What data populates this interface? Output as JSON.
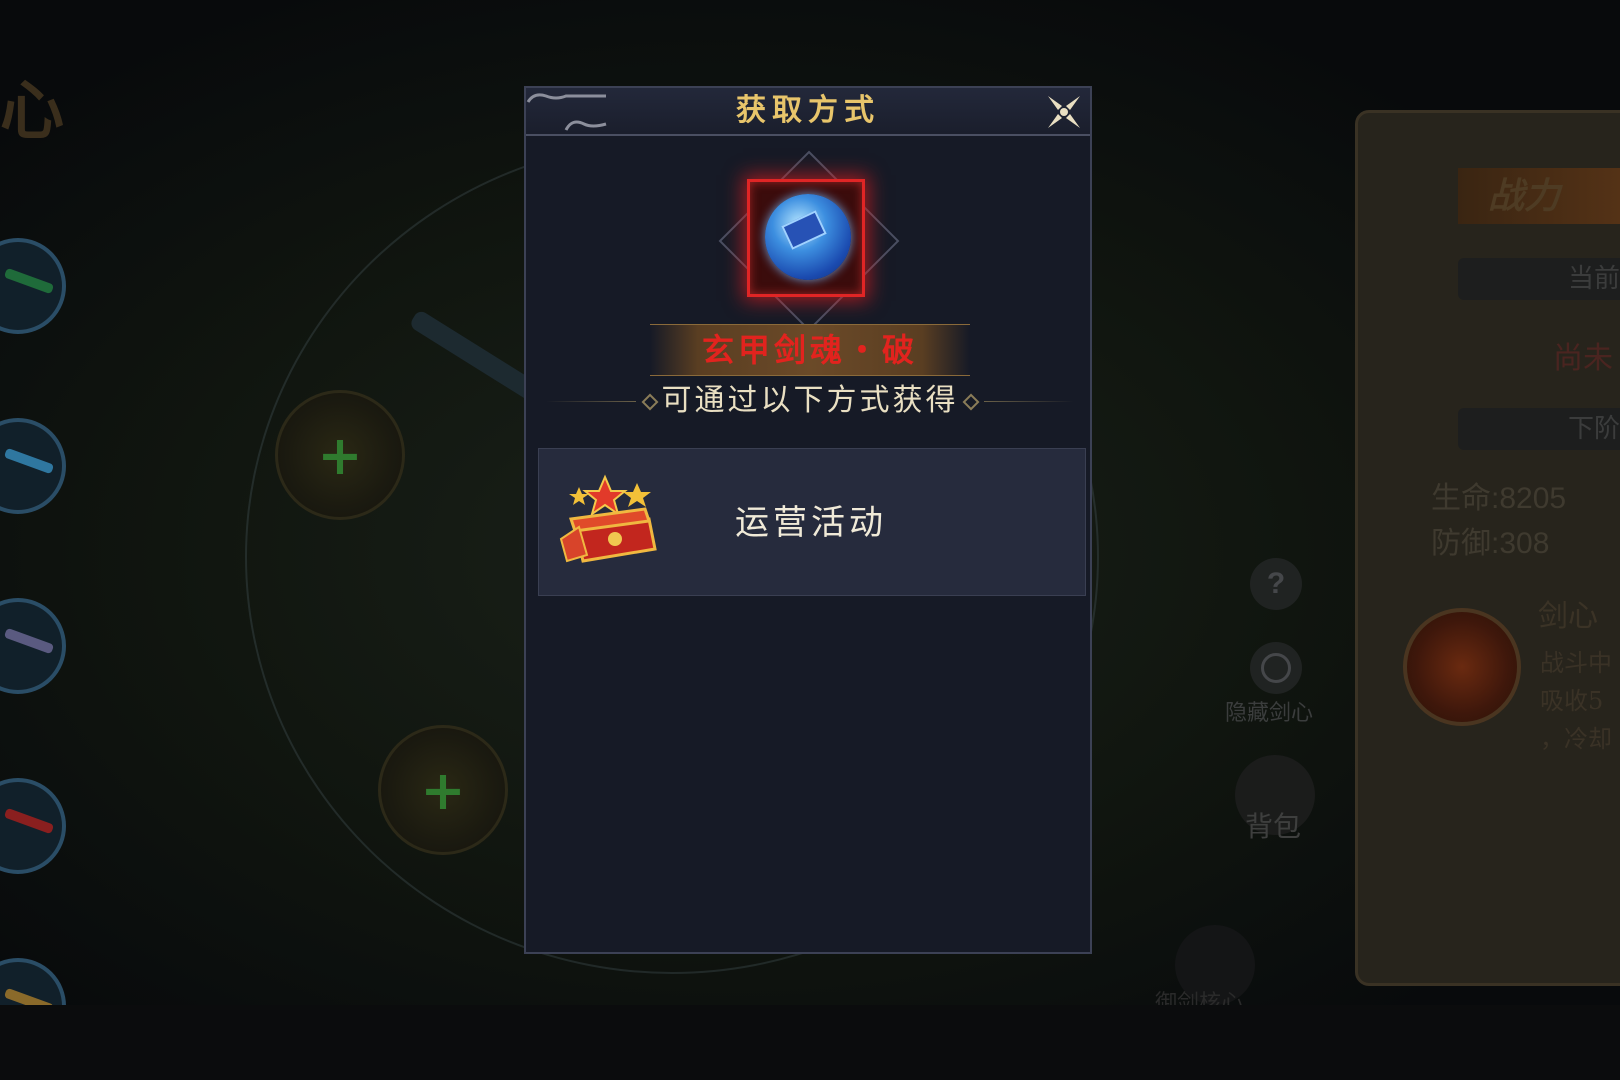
{
  "background": {
    "left_title": "心",
    "power_label": "战力",
    "current_tier_label": "当前",
    "status_text": "尚未",
    "next_tier_label": "下阶",
    "stats": [
      {
        "label": "生命:8205"
      },
      {
        "label": "防御:308"
      }
    ],
    "skill_title": "剑心",
    "skill_desc": [
      "战斗中",
      "吸收5",
      "，冷却"
    ],
    "help_button": "?",
    "hide_sword_heart_label": "隐藏剑心",
    "bag_label": "背包",
    "core_label": "御剑核心"
  },
  "dialog": {
    "title": "获取方式",
    "item_name": "玄甲剑魂・破",
    "item_name_color": "#e2231e",
    "subtitle": "可通过以下方式获得",
    "sources": [
      {
        "label": "运营活动",
        "icon": "gift-chest-icon"
      }
    ]
  }
}
